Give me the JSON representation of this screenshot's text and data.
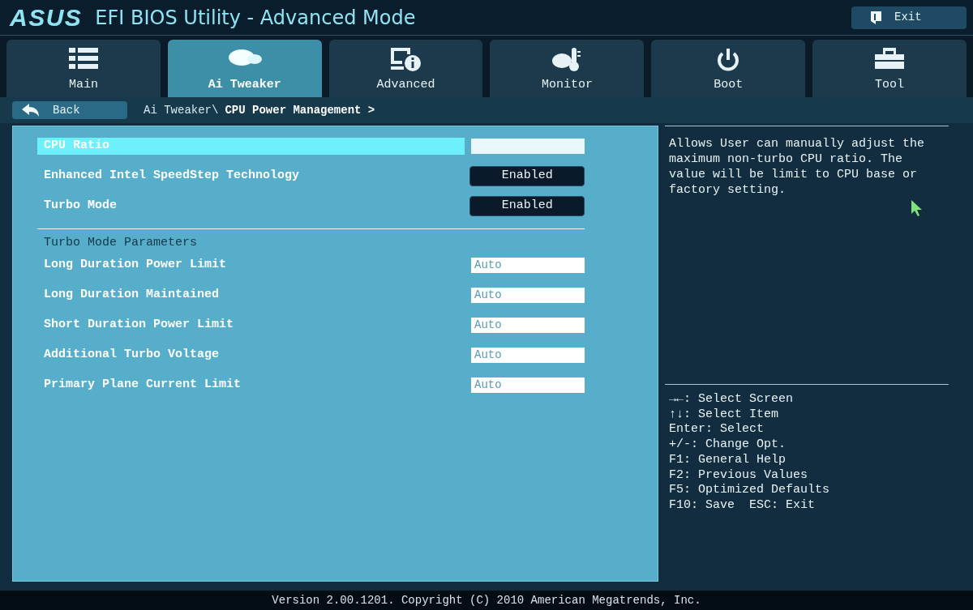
{
  "header": {
    "logo": "ASUS",
    "title": "EFI BIOS Utility - Advanced Mode",
    "exit_button": "Exit"
  },
  "tabs": [
    {
      "label": "Main",
      "selected": false
    },
    {
      "label": "Ai Tweaker",
      "selected": true
    },
    {
      "label": "Advanced",
      "selected": false
    },
    {
      "label": "Monitor",
      "selected": false
    },
    {
      "label": "Boot",
      "selected": false
    },
    {
      "label": "Tool",
      "selected": false
    }
  ],
  "navigation": {
    "back_button": "Back",
    "breadcrumb_parent": "Ai Tweaker\\",
    "breadcrumb_current": "CPU Power Management >"
  },
  "settings": [
    {
      "kind": "input",
      "label": "CPU Ratio",
      "selected": true
    },
    {
      "kind": "option",
      "label": "Enhanced Intel SpeedStep Technology",
      "value": "Enabled",
      "selected": false
    },
    {
      "kind": "option",
      "label": "Turbo Mode",
      "value": "Enabled",
      "selected": false
    },
    {
      "kind": "divider"
    },
    {
      "kind": "header",
      "label": "Turbo Mode Parameters"
    },
    {
      "kind": "value",
      "label": "Long Duration Power Limit",
      "value": "Auto",
      "selected": false
    },
    {
      "kind": "value",
      "label": "Long Duration Maintained",
      "value": "Auto",
      "selected": false
    },
    {
      "kind": "value",
      "label": "Short Duration Power Limit",
      "value": "Auto",
      "selected": false
    },
    {
      "kind": "value",
      "label": "Additional Turbo Voltage",
      "value": "Auto",
      "selected": false
    },
    {
      "kind": "value",
      "label": "Primary Plane Current Limit",
      "value": "Auto",
      "selected": false
    }
  ],
  "help_text": "Allows User can manually adjust the maximum non-turbo CPU ratio. The value will be limit to CPU base or factory setting.",
  "key_help": [
    "→←: Select Screen",
    "↑↓: Select Item",
    "Enter: Select",
    "+/-: Change Opt.",
    "F1: General Help",
    "F2: Previous Values",
    "F5: Optimized Defaults",
    "F10: Save  ESC: Exit"
  ],
  "footer": "Version 2.00.1201. Copyright (C) 2010 American Megatrends, Inc."
}
